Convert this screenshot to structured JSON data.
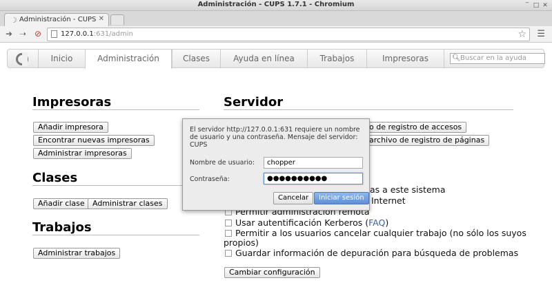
{
  "window": {
    "title": "Administración - CUPS 1.7.1 - Chromium"
  },
  "tab": {
    "title": "Administración - CUPS"
  },
  "omnibox": {
    "host": "127.0.0.1",
    "rest": ":631/admin"
  },
  "cups_nav": {
    "tabs": [
      {
        "label": "Inicio"
      },
      {
        "label": "Administración"
      },
      {
        "label": "Clases"
      },
      {
        "label": "Ayuda en línea"
      },
      {
        "label": "Trabajos"
      },
      {
        "label": "Impresoras"
      }
    ],
    "search_placeholder": "Buscar en la ayuda"
  },
  "printers": {
    "heading": "Impresoras",
    "buttons": [
      "Añadir impresora",
      "Encontrar nuevas impresoras",
      "Administrar impresoras"
    ]
  },
  "classes": {
    "heading": "Clases",
    "buttons": [
      "Añadir clase",
      "Administrar clases"
    ]
  },
  "jobs": {
    "heading": "Trabajos",
    "buttons": [
      "Administrar trabajos"
    ]
  },
  "server": {
    "heading": "Servidor",
    "buttons": [
      "o de registro de accesos",
      "archivo de registro de páginas"
    ],
    "options": {
      "share_tail": "as a este sistema",
      "internet_tail": "Internet",
      "remote_admin": "Permitir administración remota",
      "kerberos_pre": "Usar autentificación Kerberos (",
      "kerberos_link": "FAQ",
      "kerberos_post": ")",
      "cancel_jobs_line1": "Permitir a los usuarios cancelar cualquier trabajo (no sólo los suyos",
      "cancel_jobs_line2": "propios)",
      "debug": "Guardar información de depuración para búsqueda de problemas"
    },
    "change_button": "Cambiar configuración"
  },
  "auth_dialog": {
    "message": "El servidor http://127.0.0.1:631 requiere un nombre de usuario y una contraseña. Mensaje del servidor: CUPS",
    "username_label": "Nombre de usuario:",
    "username_value": "chopper",
    "password_label": "Contraseña:",
    "password_mask": "●●●●●●●●●●",
    "cancel_label": "Cancelar",
    "login_label": "Iniciar sesión"
  }
}
